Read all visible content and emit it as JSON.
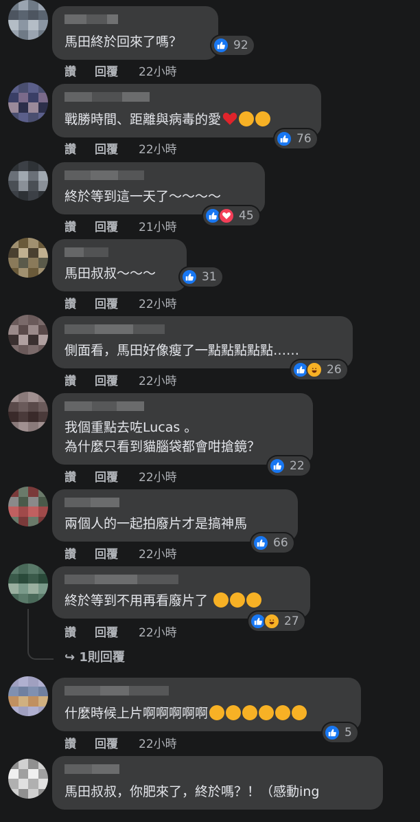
{
  "actions": {
    "like": "讚",
    "reply": "回覆"
  },
  "comments": [
    {
      "text": [
        "馬田終於回來了嗎？"
      ],
      "reactions": [
        "like"
      ],
      "count": "92",
      "time": "22小時"
    },
    {
      "text": [
        "戰勝時間、距離與病毒的愛"
      ],
      "emojis": [
        "red-heart",
        "heart-eyes",
        "star-struck"
      ],
      "reactions": [
        "like"
      ],
      "count": "76",
      "time": "22小時"
    },
    {
      "text": [
        "終於等到這一天了～～～～"
      ],
      "reactions": [
        "like",
        "love"
      ],
      "count": "45",
      "time": "21小時"
    },
    {
      "text": [
        "馬田叔叔～～～"
      ],
      "reactions": [
        "like"
      ],
      "count": "31",
      "time": "22小時"
    },
    {
      "text": [
        "側面看，馬田好像瘦了一點點點點點……"
      ],
      "reactions": [
        "like",
        "haha"
      ],
      "count": "26",
      "time": "22小時"
    },
    {
      "text": [
        "我個重點去咗Lucas 。",
        "為什麼只看到貓腦袋都會咁搶鏡？"
      ],
      "reactions": [
        "like"
      ],
      "count": "22",
      "time": "22小時"
    },
    {
      "text": [
        "兩個人的一起拍廢片才是搞神馬"
      ],
      "reactions": [
        "like"
      ],
      "count": "66",
      "time": "22小時"
    },
    {
      "text": [
        "終於等到不用再看廢片了"
      ],
      "emojis": [
        "rofl",
        "rofl",
        "rofl"
      ],
      "reactions": [
        "like",
        "haha"
      ],
      "count": "27",
      "time": "22小時"
    },
    {
      "text": [
        "什麼時候上片啊啊啊啊啊"
      ],
      "emojis": [
        "rofl",
        "rofl",
        "rofl",
        "rofl",
        "rofl",
        "grinning"
      ],
      "reactions": [
        "like"
      ],
      "count": "5",
      "time": "22小時"
    },
    {
      "text": [
        "馬田叔叔，你肥來了，終於嗎？！（感動ing"
      ],
      "reactions": [],
      "count": "",
      "time": ""
    }
  ],
  "replies_link": "1則回覆",
  "colors": {
    "background": "#18191a",
    "bubble": "#3a3b3c",
    "text": "#e4e6eb",
    "secondary": "#b0b3b8",
    "like": "#1877f2",
    "love": "#f33e58",
    "haha": "#f7b125"
  }
}
